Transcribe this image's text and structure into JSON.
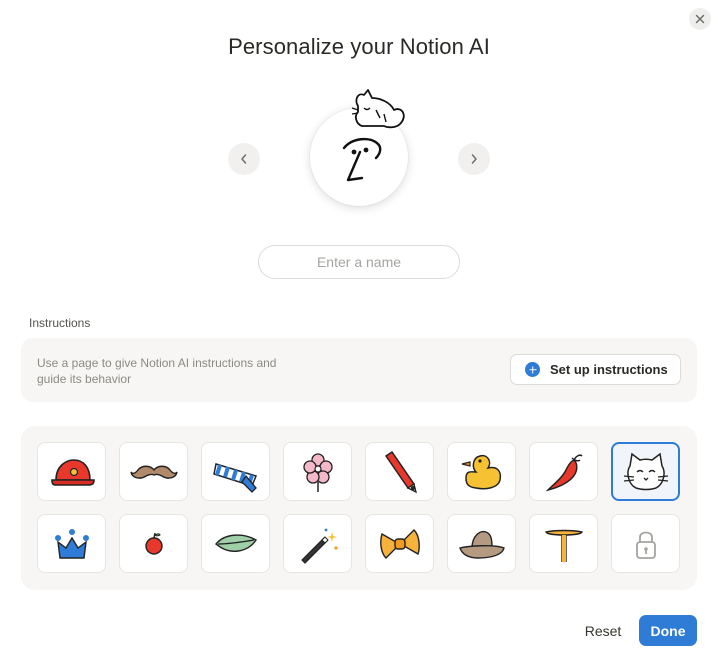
{
  "dialog": {
    "title": "Personalize your Notion AI",
    "close_icon": "close-icon"
  },
  "avatar": {
    "prev_icon": "chevron-left-icon",
    "next_icon": "chevron-right-icon",
    "accessory": "cat-accessory",
    "face": "notion-ai-face"
  },
  "name_input": {
    "value": "",
    "placeholder": "Enter a name"
  },
  "instructions": {
    "label": "Instructions",
    "description": "Use a page to give Notion AI instructions and guide its behavior",
    "button_label": "Set up instructions",
    "button_icon": "plus-circle-icon"
  },
  "accessories": {
    "selected": "cat",
    "items": [
      {
        "id": "hard-hat",
        "icon": "hard-hat-icon"
      },
      {
        "id": "mustache",
        "icon": "mustache-icon"
      },
      {
        "id": "scarf",
        "icon": "scarf-icon"
      },
      {
        "id": "flower",
        "icon": "flower-icon"
      },
      {
        "id": "pencil",
        "icon": "pencil-icon"
      },
      {
        "id": "duck",
        "icon": "duck-icon"
      },
      {
        "id": "chili",
        "icon": "chili-pepper-icon"
      },
      {
        "id": "cat",
        "icon": "cat-icon"
      },
      {
        "id": "crown",
        "icon": "crown-icon"
      },
      {
        "id": "apple",
        "icon": "apple-icon"
      },
      {
        "id": "leaf",
        "icon": "leaf-icon"
      },
      {
        "id": "magic-wand",
        "icon": "magic-wand-icon"
      },
      {
        "id": "bow-tie",
        "icon": "bow-tie-icon"
      },
      {
        "id": "cowboy-hat",
        "icon": "cowboy-hat-icon"
      },
      {
        "id": "propeller",
        "icon": "propeller-icon"
      },
      {
        "id": "locked",
        "icon": "lock-icon"
      }
    ]
  },
  "footer": {
    "reset_label": "Reset",
    "done_label": "Done"
  },
  "colors": {
    "accent": "#2e7cd6",
    "panel": "#f7f6f4",
    "text": "#37352f"
  }
}
